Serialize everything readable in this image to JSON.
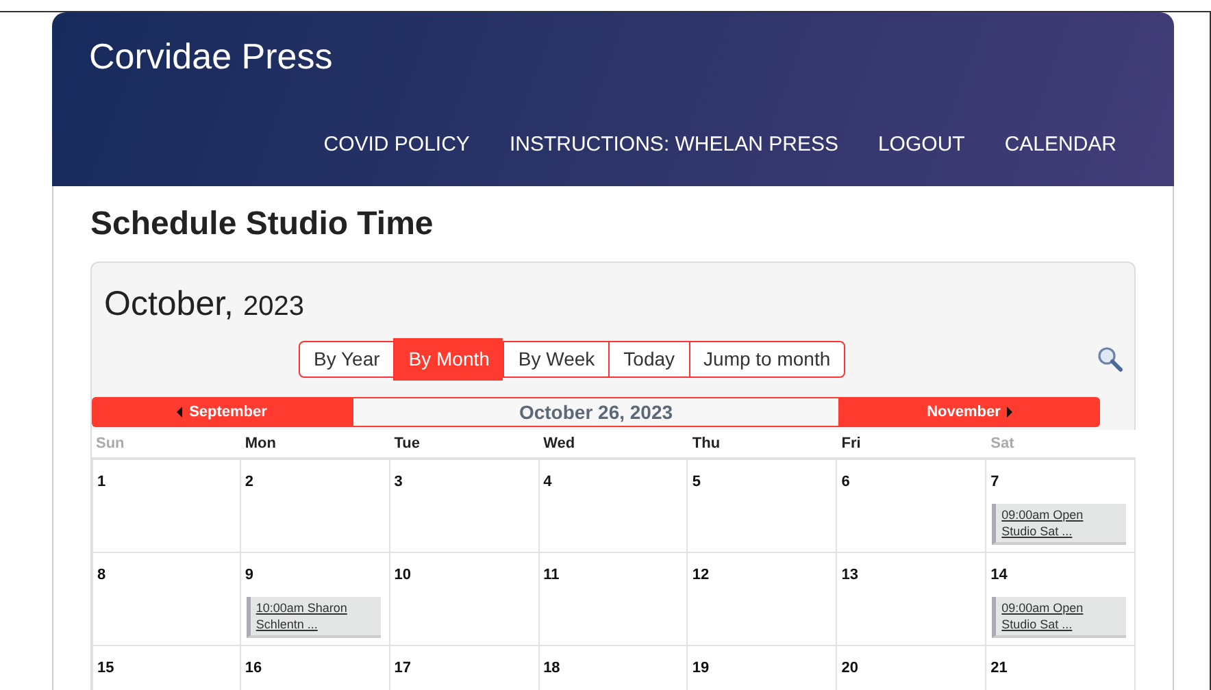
{
  "site": {
    "title": "Corvidae Press",
    "nav": [
      "COVID POLICY",
      "INSTRUCTIONS: WHELAN PRESS",
      "LOGOUT",
      "CALENDAR"
    ]
  },
  "page_title": "Schedule Studio Time",
  "calendar": {
    "month": "October,",
    "year": "2023",
    "views": [
      {
        "label": "By Year",
        "selected": false
      },
      {
        "label": "By Month",
        "selected": true
      },
      {
        "label": "By Week",
        "selected": false
      },
      {
        "label": "Today",
        "selected": false
      },
      {
        "label": "Jump to month",
        "selected": false
      }
    ],
    "prev": "September",
    "current_date": "October 26, 2023",
    "next": "November",
    "weekdays": [
      {
        "label": "Sun",
        "weekend": true
      },
      {
        "label": "Mon",
        "weekend": false
      },
      {
        "label": "Tue",
        "weekend": false
      },
      {
        "label": "Wed",
        "weekend": false
      },
      {
        "label": "Thu",
        "weekend": false
      },
      {
        "label": "Fri",
        "weekend": false
      },
      {
        "label": "Sat",
        "weekend": true
      }
    ],
    "weeks": [
      [
        {
          "day": "1"
        },
        {
          "day": "2"
        },
        {
          "day": "3"
        },
        {
          "day": "4"
        },
        {
          "day": "5"
        },
        {
          "day": "6"
        },
        {
          "day": "7",
          "events": [
            "09:00am Open Studio Sat ..."
          ]
        }
      ],
      [
        {
          "day": "8"
        },
        {
          "day": "9",
          "events": [
            "10:00am Sharon Schlentn ..."
          ]
        },
        {
          "day": "10"
        },
        {
          "day": "11"
        },
        {
          "day": "12"
        },
        {
          "day": "13"
        },
        {
          "day": "14",
          "events": [
            "09:00am Open Studio Sat ..."
          ]
        }
      ],
      [
        {
          "day": "15"
        },
        {
          "day": "16"
        },
        {
          "day": "17"
        },
        {
          "day": "18"
        },
        {
          "day": "19"
        },
        {
          "day": "20"
        },
        {
          "day": "21"
        }
      ]
    ]
  }
}
